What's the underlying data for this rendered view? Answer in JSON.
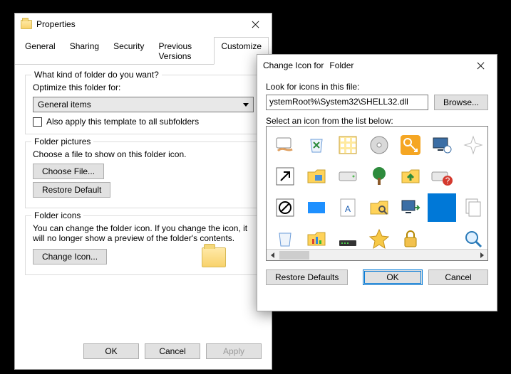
{
  "properties": {
    "title": "Properties",
    "tabs": [
      "General",
      "Sharing",
      "Security",
      "Previous Versions",
      "Customize"
    ],
    "active_tab_index": 4,
    "kind": {
      "legend": "What kind of folder do you want?",
      "optimize_label": "Optimize this folder for:",
      "select_value": "General items",
      "checkbox_label": "Also apply this template to all subfolders"
    },
    "pictures": {
      "legend": "Folder pictures",
      "hint": "Choose a file to show on this folder icon.",
      "choose_btn": "Choose File...",
      "restore_btn": "Restore Default"
    },
    "icons": {
      "legend": "Folder icons",
      "hint": "You can change the folder icon. If you change the icon, it will no longer show a preview of the folder's contents.",
      "change_btn": "Change Icon..."
    },
    "footer": {
      "ok": "OK",
      "cancel": "Cancel",
      "apply": "Apply"
    }
  },
  "change_icon": {
    "title_prefix": "Change Icon for",
    "title_target": "Folder",
    "look_label": "Look for icons in this file:",
    "path_value": "ystemRoot%\\System32\\SHELL32.dll",
    "browse_btn": "Browse...",
    "select_label": "Select an icon from the list below:",
    "restore_btn": "Restore Defaults",
    "ok": "OK",
    "cancel": "Cancel",
    "icons": [
      "hand-share",
      "recycle-bin",
      "grid-view",
      "cd-disc",
      "key",
      "monitor-settings",
      "sparkle",
      "overlay-arrow",
      "folder-app",
      "drive",
      "tree",
      "folder-up",
      "drive-help",
      "blank",
      "overlay-block",
      "blue-square",
      "font-file",
      "folder-search",
      "computer-go",
      "blue-sel",
      "documents",
      "recycle-empty",
      "folder-chart",
      "modem",
      "star-fav",
      "lock",
      "blank2",
      "magnifier"
    ],
    "selected_index": 19
  }
}
